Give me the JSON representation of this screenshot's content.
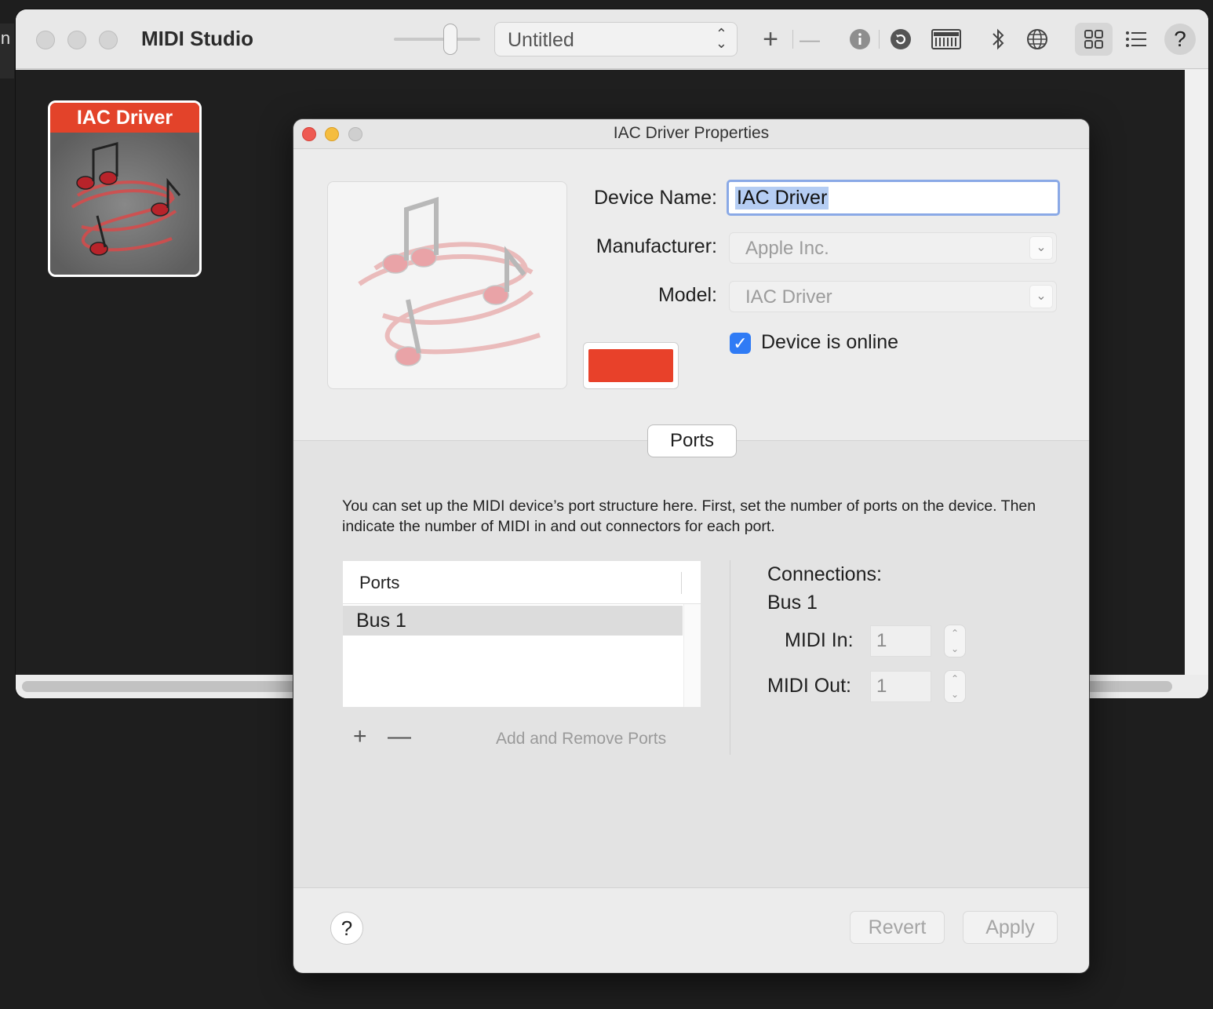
{
  "background_window": {
    "edge_text": "in"
  },
  "studio": {
    "title": "MIDI Studio",
    "configuration": "Untitled",
    "toolbar": {
      "add_label": "+",
      "remove_label": "—",
      "help_label": "?"
    },
    "device": {
      "name": "IAC Driver"
    }
  },
  "dialog": {
    "title": "IAC Driver Properties",
    "device_name_label": "Device Name:",
    "device_name_value": "IAC Driver",
    "manufacturer_label": "Manufacturer:",
    "manufacturer_value": "Apple Inc.",
    "model_label": "Model:",
    "model_value": "IAC Driver",
    "device_color": "#e8412a",
    "online_label": "Device is online",
    "online_checked": true,
    "ports_tab": "Ports",
    "description": "You can set up the MIDI device’s port structure here. First, set the number of ports on the device. Then indicate the number of MIDI in and out connectors for each port.",
    "ports_table": {
      "header": "Ports",
      "rows": [
        "Bus 1"
      ]
    },
    "add_port": "+",
    "remove_port": "—",
    "add_remove_label": "Add and Remove Ports",
    "connections_label": "Connections:",
    "selected_port": "Bus 1",
    "midi_in_label": "MIDI In:",
    "midi_in_value": "1",
    "midi_out_label": "MIDI Out:",
    "midi_out_value": "1",
    "help_label": "?",
    "revert_label": "Revert",
    "apply_label": "Apply"
  }
}
